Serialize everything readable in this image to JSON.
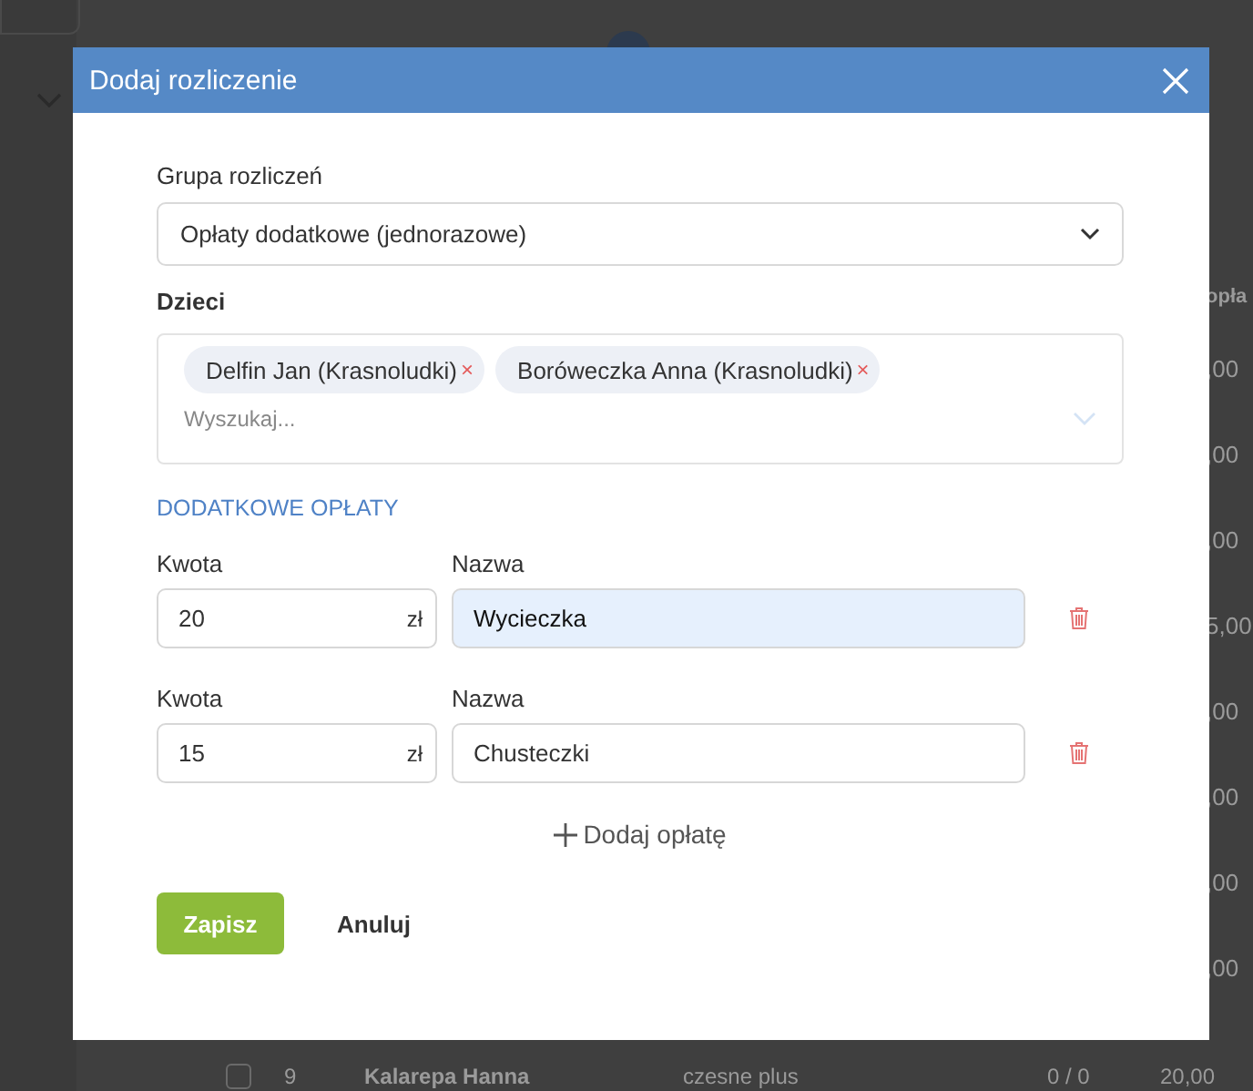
{
  "background": {
    "column_header": "opła",
    "column_values": [
      ",00",
      ",00",
      ",00",
      "5,00",
      ",00",
      ",00",
      ",00",
      ",00"
    ],
    "last_row": {
      "checked": false,
      "number": "9",
      "name": "Kalarepa Hanna",
      "type": "czesne plus",
      "count": "0 / 0",
      "amount": "20,00"
    }
  },
  "dialog": {
    "title": "Dodaj rozliczenie",
    "group": {
      "label": "Grupa rozliczeń",
      "value": "Opłaty dodatkowe (jednorazowe)"
    },
    "children": {
      "label": "Dzieci",
      "tags": [
        "Delfin Jan (Krasnoludki)",
        "Boróweczka Anna (Krasnoludki)"
      ],
      "remove_mark": "×",
      "placeholder": "Wyszukaj..."
    },
    "fees_heading": "DODATKOWE OPŁATY",
    "fees": [
      {
        "amount_label": "Kwota",
        "amount": "20",
        "currency": "zł",
        "name_label": "Nazwa",
        "name": "Wycieczka",
        "highlighted": true
      },
      {
        "amount_label": "Kwota",
        "amount": "15",
        "currency": "zł",
        "name_label": "Nazwa",
        "name": "Chusteczki",
        "highlighted": false
      }
    ],
    "add_fee": "Dodaj opłatę",
    "buttons": {
      "save": "Zapisz",
      "cancel": "Anuluj"
    }
  }
}
